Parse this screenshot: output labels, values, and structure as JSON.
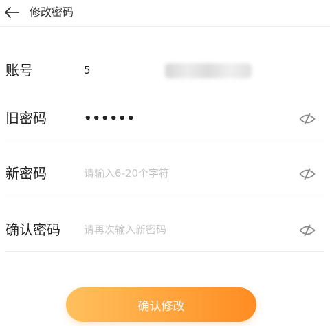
{
  "header": {
    "back_icon": "arrow-left-icon",
    "title": "修改密码"
  },
  "form": {
    "account": {
      "label": "账号",
      "value": "5",
      "value_obscured": true
    },
    "old_password": {
      "label": "旧密码",
      "value": "••••••",
      "icon": "eye-off-icon"
    },
    "new_password": {
      "label": "新密码",
      "placeholder": "请输入6-20个字符",
      "icon": "eye-off-icon"
    },
    "confirm_password": {
      "label": "确认密码",
      "placeholder": "请再次输入新密码",
      "icon": "eye-off-icon"
    }
  },
  "submit": {
    "label": "确认修改"
  },
  "colors": {
    "accent_start": "#ffc05e",
    "accent_end": "#ff8c22",
    "placeholder": "#c6c6c6",
    "divider": "#eeeeee"
  }
}
